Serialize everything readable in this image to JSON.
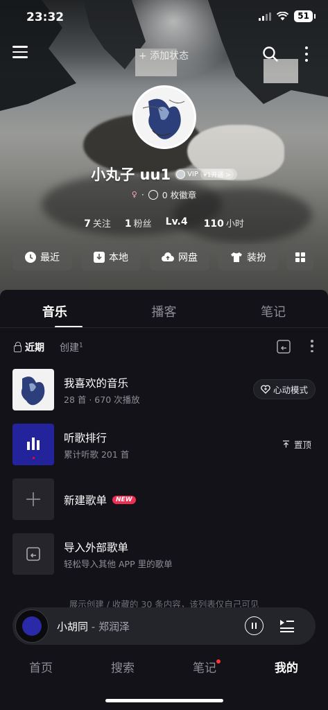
{
  "status_bar": {
    "time": "23:32",
    "battery": "51"
  },
  "header": {
    "add_status": "+ 添加状态"
  },
  "profile": {
    "name": "小丸子 uu1",
    "vip_label": "VIP",
    "vip_open": "¥1开通 >",
    "gender_symbol": "♀",
    "badges": "0 枚徽章",
    "stats": [
      {
        "value": "7",
        "unit": "关注"
      },
      {
        "value": "1",
        "unit": "粉丝"
      },
      {
        "value": "Lv.4",
        "unit": ""
      },
      {
        "value": "110",
        "unit": "小时"
      }
    ]
  },
  "quick_buttons": [
    {
      "label": "最近",
      "icon": "clock-icon"
    },
    {
      "label": "本地",
      "icon": "download-box-icon"
    },
    {
      "label": "网盘",
      "icon": "cloud-upload-icon"
    },
    {
      "label": "装扮",
      "icon": "shirt-icon"
    }
  ],
  "tabs": [
    "音乐",
    "播客",
    "笔记"
  ],
  "subfilter": {
    "recent": "近期",
    "created": "创建",
    "created_count": "1"
  },
  "playlists": [
    {
      "title": "我喜欢的音乐",
      "subtitle": "28 首 · 670 次播放",
      "action": "心动模式"
    },
    {
      "title": "听歌排行",
      "subtitle": "累计听歌 201 首",
      "action": "置顶"
    },
    {
      "title": "新建歌单",
      "badge": "NEW"
    },
    {
      "title": "导入外部歌单",
      "subtitle": "轻松导入其他 APP 里的歌单"
    }
  ],
  "footer_note": "展示创建 / 收藏的 30 条内容，该列表仅自己可见",
  "player": {
    "song": "小胡同",
    "separator": " - ",
    "artist": "郑润泽"
  },
  "bottom_nav": [
    "首页",
    "搜索",
    "笔记",
    "我的"
  ],
  "colors": {
    "accent_red": "#ee2e52",
    "sheet_bg": "#121218",
    "player_disc": "#2a2aa8"
  }
}
